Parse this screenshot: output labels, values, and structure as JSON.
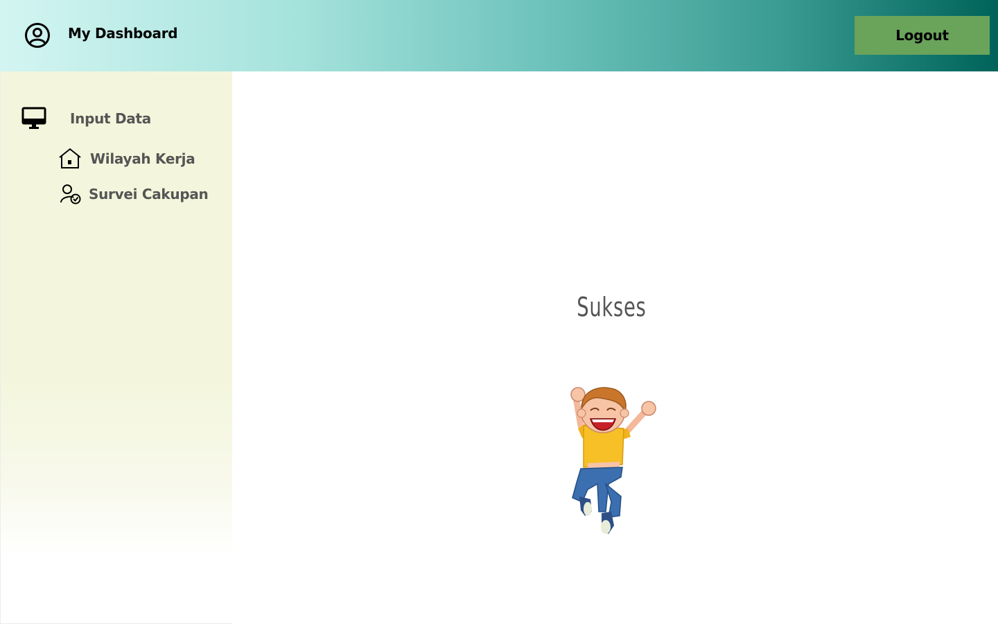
{
  "header": {
    "title": "My Dashboard",
    "logout_label": "Logout",
    "icon": "user-circle-icon"
  },
  "sidebar": {
    "items": [
      {
        "label": "Input Data",
        "icon": "monitor-icon"
      },
      {
        "label": "Wilayah Kerja",
        "icon": "house-icon"
      },
      {
        "label": "Survei Cakupan",
        "icon": "user-check-icon"
      }
    ]
  },
  "main": {
    "message": "Sukses",
    "illustration": "jumping-kid-illustration"
  },
  "colors": {
    "header_gradient_start": "#d3f5f2",
    "header_gradient_end": "#00635a",
    "logout_button": "#6aa35a",
    "sidebar_bg": "#f3f6dc"
  }
}
